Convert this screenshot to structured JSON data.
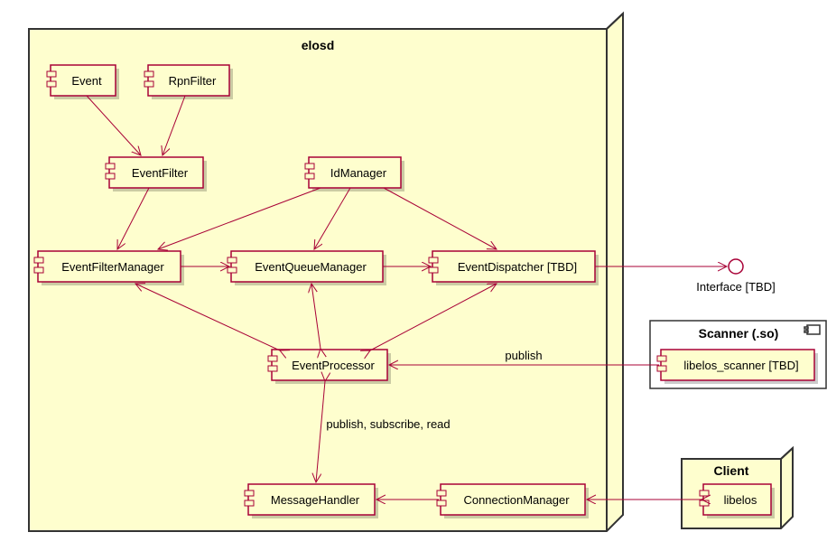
{
  "containers": {
    "elosd": {
      "title": "elosd"
    },
    "scanner": {
      "title": "Scanner (.so)"
    },
    "client": {
      "title": "Client"
    }
  },
  "components": {
    "event": "Event",
    "rpnfilter": "RpnFilter",
    "eventfilter": "EventFilter",
    "idmanager": "IdManager",
    "eventfiltermanager": "EventFilterManager",
    "eventqueuemanager": "EventQueueManager",
    "eventdispatcher": "EventDispatcher [TBD]",
    "eventprocessor": "EventProcessor",
    "messagehandler": "MessageHandler",
    "connectionmanager": "ConnectionManager",
    "libelos_scanner": "libelos_scanner [TBD]",
    "libelos": "libelos"
  },
  "interface": "Interface [TBD]",
  "edges": {
    "publish": "publish",
    "psr": "publish, subscribe, read"
  }
}
